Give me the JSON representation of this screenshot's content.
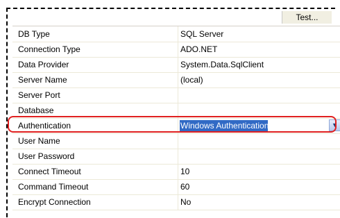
{
  "toolbar": {
    "test_label": "Test..."
  },
  "properties": [
    {
      "name": "DB Type",
      "value": "SQL Server"
    },
    {
      "name": "Connection Type",
      "value": "ADO.NET"
    },
    {
      "name": "Data Provider",
      "value": "System.Data.SqlClient"
    },
    {
      "name": "Server Name",
      "value": "(local)"
    },
    {
      "name": "Server Port",
      "value": ""
    },
    {
      "name": "Database",
      "value": ""
    },
    {
      "name": "Authentication",
      "value": "Windows Authentication"
    },
    {
      "name": "User Name",
      "value": ""
    },
    {
      "name": "User Password",
      "value": ""
    },
    {
      "name": "Connect Timeout",
      "value": "10"
    },
    {
      "name": "Command Timeout",
      "value": "60"
    },
    {
      "name": "Encrypt Connection",
      "value": "No"
    }
  ],
  "colors": {
    "selection": "#316ac5",
    "highlight_outline": "#e02020",
    "grid_line": "#ece9d8"
  },
  "icons": {
    "dropdown": "chevron-down-icon"
  }
}
